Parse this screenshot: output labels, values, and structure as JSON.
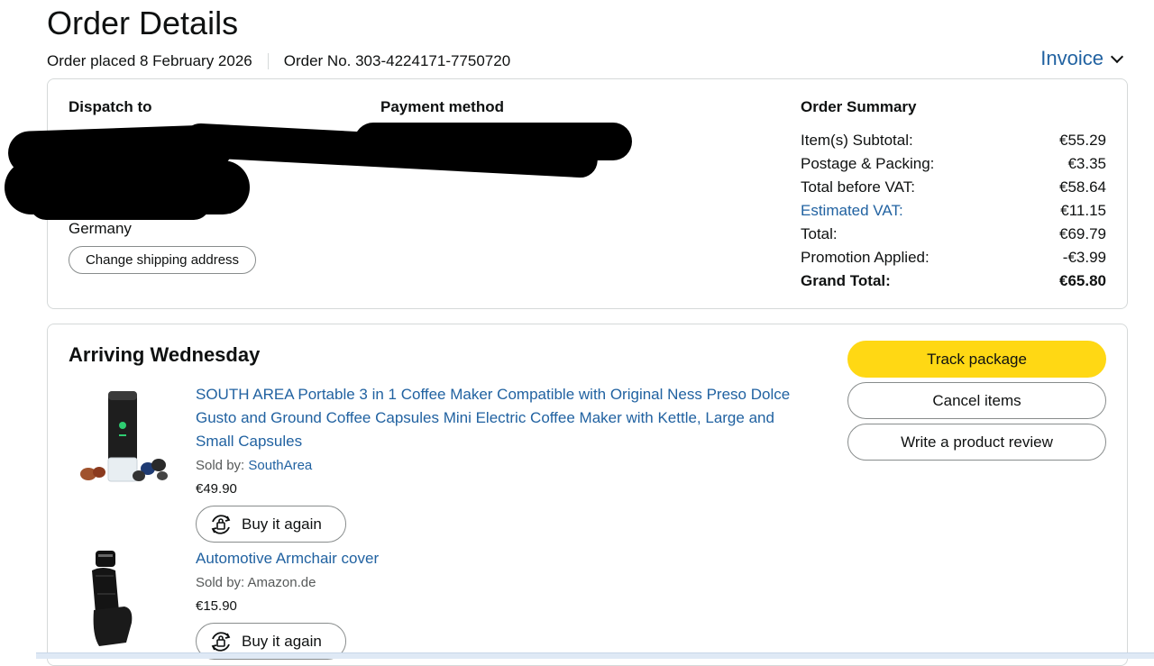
{
  "header": {
    "title": "Order Details",
    "order_placed": "Order placed 8 February 2026",
    "order_number": "Order No. 303-4224171-7750720",
    "invoice_label": "Invoice"
  },
  "dispatch": {
    "heading": "Dispatch to",
    "country": "Germany",
    "change_address_label": "Change shipping address"
  },
  "payment": {
    "heading": "Payment method"
  },
  "summary": {
    "heading": "Order Summary",
    "rows": [
      {
        "label": "Item(s) Subtotal:",
        "value": "€55.29"
      },
      {
        "label": "Postage & Packing:",
        "value": "€3.35"
      },
      {
        "label": "Total before VAT:",
        "value": "€58.64"
      },
      {
        "label": "Estimated VAT:",
        "value": "€11.15"
      },
      {
        "label": "Total:",
        "value": "€69.79"
      },
      {
        "label": "Promotion Applied:",
        "value": "-€3.99"
      },
      {
        "label": "Grand Total:",
        "value": "€65.80"
      }
    ]
  },
  "shipment": {
    "heading": "Arriving Wednesday",
    "actions": {
      "track": "Track package",
      "cancel": "Cancel items",
      "review": "Write a product review"
    },
    "items": [
      {
        "title": "SOUTH AREA Portable 3 in 1 Coffee Maker Compatible with Original Ness Preso Dolce Gusto and Ground Coffee Capsules Mini Electric Coffee Maker with Kettle, Large and Small Capsules",
        "sold_by_label": "Sold by: ",
        "seller": "SouthArea",
        "price": "€49.90",
        "buy_again": "Buy it again"
      },
      {
        "title": "Automotive Armchair cover",
        "sold_by_label": "Sold by: Amazon.de",
        "seller": "",
        "price": "€15.90",
        "buy_again": "Buy it again"
      }
    ]
  },
  "colors": {
    "link": "#2162a1",
    "primary_button": "#ffd814",
    "border": "#d5d9d9"
  }
}
